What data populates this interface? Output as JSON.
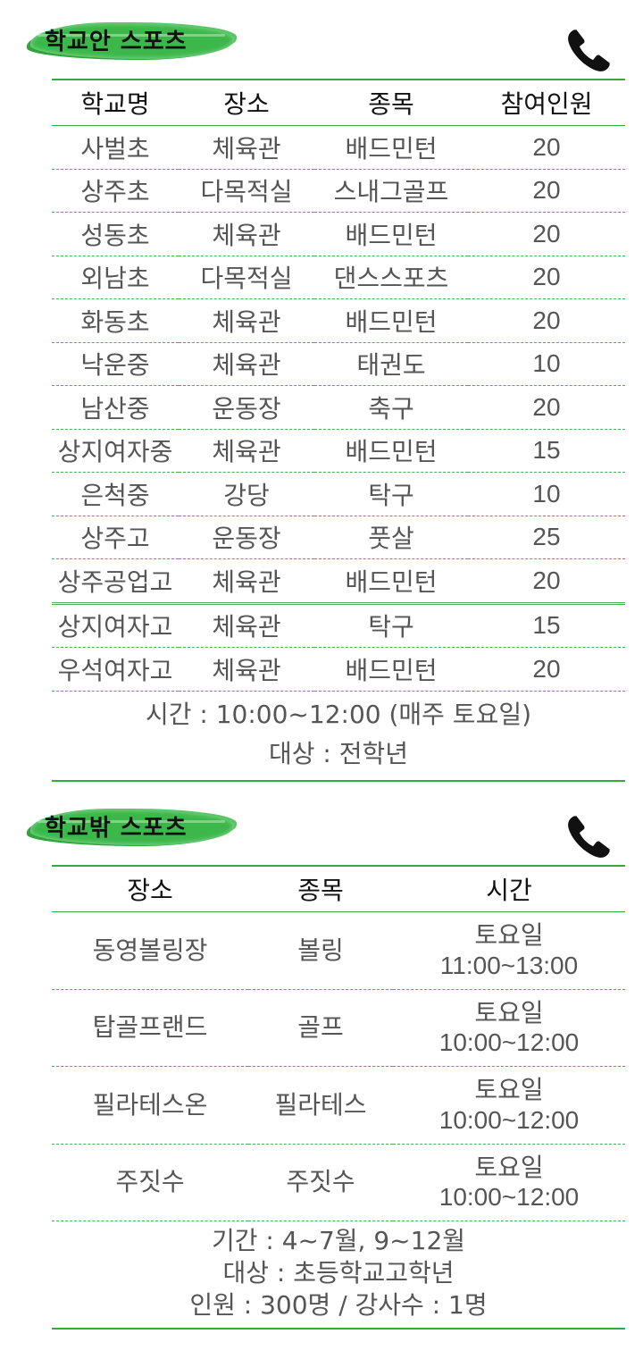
{
  "in_school": {
    "title": "학교안 스포츠",
    "headers": [
      "학교명",
      "장소",
      "종목",
      "참여인원"
    ],
    "rows": [
      [
        "사벌초",
        "체육관",
        "배드민턴",
        "20"
      ],
      [
        "상주초",
        "다목적실",
        "스내그골프",
        "20"
      ],
      [
        "성동초",
        "체육관",
        "배드민턴",
        "20"
      ],
      [
        "외남초",
        "다목적실",
        "댄스스포츠",
        "20"
      ],
      [
        "화동초",
        "체육관",
        "배드민턴",
        "20"
      ],
      [
        "낙운중",
        "체육관",
        "태권도",
        "10"
      ],
      [
        "남산중",
        "운동장",
        "축구",
        "20"
      ],
      [
        "상지여자중",
        "체육관",
        "배드민턴",
        "15"
      ],
      [
        "은척중",
        "강당",
        "탁구",
        "10"
      ],
      [
        "상주고",
        "운동장",
        "풋살",
        "25"
      ],
      [
        "상주공업고",
        "체육관",
        "배드민턴",
        "20"
      ],
      [
        "상지여자고",
        "체육관",
        "탁구",
        "15"
      ],
      [
        "우석여자고",
        "체육관",
        "배드민턴",
        "20"
      ]
    ],
    "footer": [
      "시간 : 10:00~12:00 (매주 토요일)",
      "대상 : 전학년"
    ]
  },
  "out_school": {
    "title": "학교밖 스포츠",
    "headers": [
      "장소",
      "종목",
      "시간"
    ],
    "rows": [
      [
        "동영볼링장",
        "볼링",
        "토요일",
        "11:00~13:00"
      ],
      [
        "탑골프랜드",
        "골프",
        "토요일",
        "10:00~12:00"
      ],
      [
        "필라테스온",
        "필라테스",
        "토요일",
        "10:00~12:00"
      ],
      [
        "주짓수",
        "주짓수",
        "토요일",
        "10:00~12:00"
      ]
    ],
    "footer": [
      "기간 : 4~7월, 9~12월",
      "대상 : 초등학교고학년",
      "인원 : 300명 / 강사수 : 1명"
    ]
  },
  "icons": {
    "phone": "phone-icon",
    "accent": "#34a93f"
  }
}
